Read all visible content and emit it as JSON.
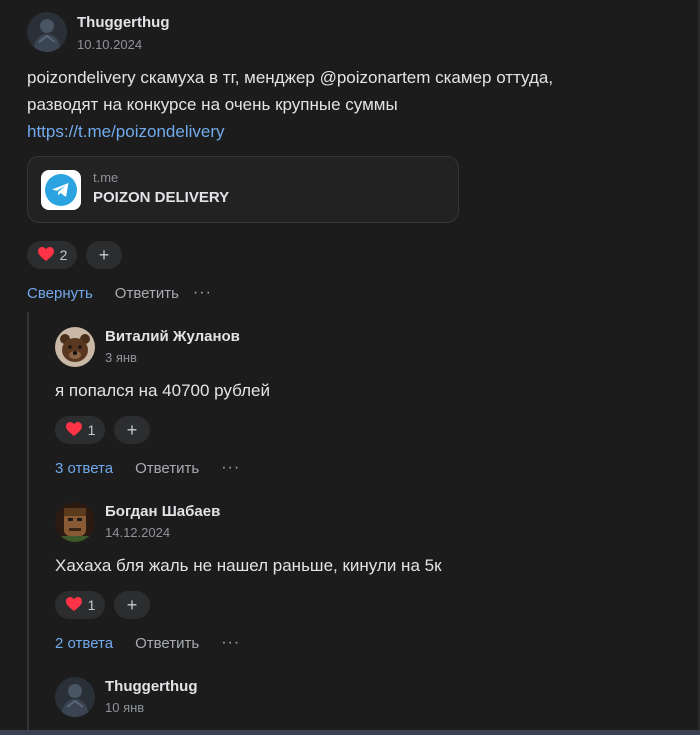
{
  "post": {
    "author": "Thuggerthug",
    "date": "10.10.2024",
    "text_line1": "poizondelivery скамуха в тг, менджер @poizonartem скамер оттуда,",
    "text_line2": "разводят на конкурсе на очень крупные суммы",
    "link": "https://t.me/poizondelivery",
    "card": {
      "domain": "t.me",
      "title": "POIZON DELIVERY",
      "icon": "telegram-icon"
    },
    "likes": "2",
    "actions": {
      "collapse": "Свернуть",
      "reply": "Ответить",
      "more": "···"
    }
  },
  "replies": [
    {
      "author": "Виталий Жуланов",
      "date": "3 янв",
      "text": "я попался на 40700 рублей",
      "likes": "1",
      "replies_link": "3 ответа",
      "reply": "Ответить",
      "more": "···"
    },
    {
      "author": "Богдан Шабаев",
      "date": "14.12.2024",
      "text": "Хахаха бля жаль не нашел раньше, кинули на 5к",
      "likes": "1",
      "replies_link": "2 ответа",
      "reply": "Ответить",
      "more": "···"
    },
    {
      "author": "Thuggerthug",
      "date": "10 янв"
    }
  ],
  "colors": {
    "background": "#1c1c1d",
    "link": "#71aaeb",
    "like": "#ff3347"
  }
}
